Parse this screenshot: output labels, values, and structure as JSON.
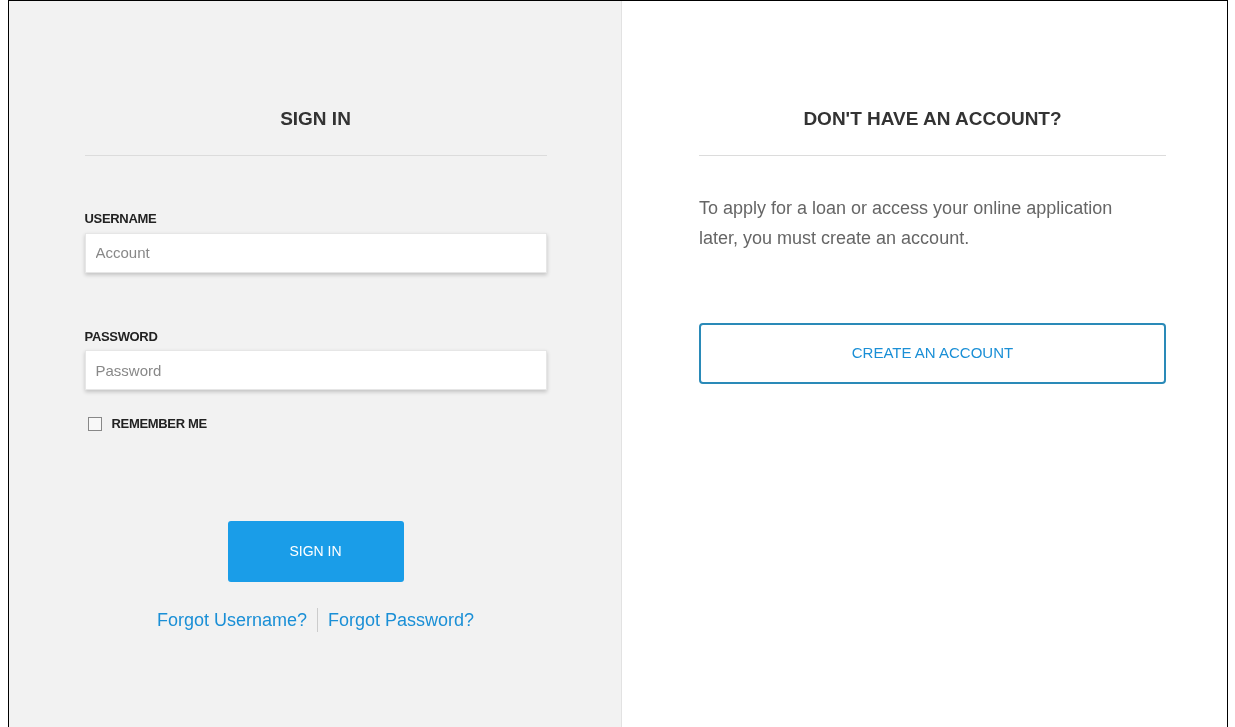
{
  "sign_in": {
    "title": "SIGN IN",
    "username": {
      "label": "USERNAME",
      "placeholder": "Account"
    },
    "password": {
      "label": "PASSWORD",
      "placeholder": "Password"
    },
    "remember_me": {
      "label": "REMEMBER ME",
      "checked": false
    },
    "button": "SIGN IN",
    "links": [
      "Forgot Username?",
      "Forgot Password?"
    ]
  },
  "register": {
    "title": "DON'T HAVE AN ACCOUNT?",
    "text": "To apply for a loan or access your online application later, you must create an account.",
    "button": "CREATE AN ACCOUNT"
  }
}
